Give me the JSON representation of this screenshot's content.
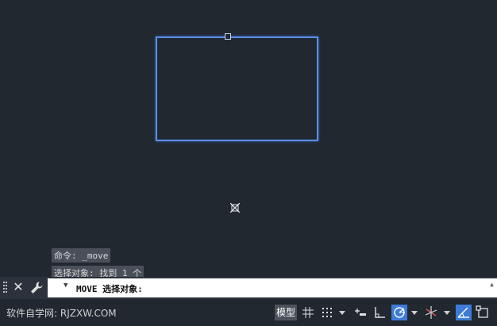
{
  "history": [
    "命令: _move",
    "选择对象: 找到 1 个"
  ],
  "command_line": {
    "prompt": "MOVE 选择对象:"
  },
  "status_bar": {
    "watermark": "软件自学网: RJZXW.COM",
    "model_tab": "模型",
    "buttons": [
      {
        "icon": "grid-icon",
        "active": false
      },
      {
        "icon": "snap-grid-icon",
        "active": false
      },
      {
        "icon": "infer-constraints-icon",
        "active": false
      },
      {
        "icon": "ortho-icon",
        "active": false
      },
      {
        "icon": "polar-tracking-icon",
        "active": true
      },
      {
        "icon": "isometric-icon",
        "active": false
      },
      {
        "icon": "object-snap-tracking-icon",
        "active": true
      },
      {
        "icon": "object-snap-icon",
        "active": false
      }
    ]
  },
  "colors": {
    "canvas": "#212830",
    "selection": "#5b8fe8",
    "active_button": "#3d7bd6"
  }
}
